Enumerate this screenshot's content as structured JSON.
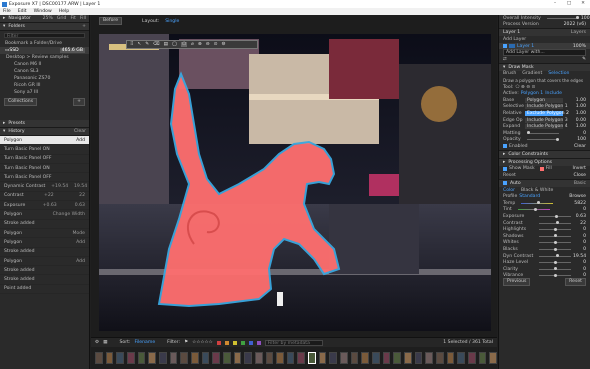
{
  "window": {
    "title": "Exposure X7 | DSC00177.ARW | Layer 1",
    "min": "–",
    "max": "□",
    "close": "✕"
  },
  "menu": [
    "File",
    "Edit",
    "Window",
    "Help"
  ],
  "navigator": {
    "title": "Navigator",
    "zoom": "25%",
    "grid": "Grid",
    "fit": "Fit",
    "fill": "Fill",
    "full": "1:1"
  },
  "folders": {
    "title": "Folders",
    "filter_placeholder": "Filter",
    "bookmark": "Bookmark a Folder/Drive",
    "drive": "SSD",
    "drive_size": "465.6 GB",
    "items": [
      {
        "label": "Desktop > Review samples",
        "level": 0
      },
      {
        "label": "Canon M6 II",
        "level": 1
      },
      {
        "label": "Canon SL3",
        "level": 1
      },
      {
        "label": "Panasonic ZS70",
        "level": 1
      },
      {
        "label": "Ricoh GR III",
        "level": 1
      },
      {
        "label": "Sony a7 III",
        "level": 1
      }
    ],
    "collections": "Collections"
  },
  "presets": {
    "title": "Presets"
  },
  "history": {
    "title": "History",
    "clear": "Clear",
    "rows": [
      {
        "label": "Polygon",
        "a": "Add",
        "b": ""
      },
      {
        "label": "Turn Basic Panel ON",
        "a": "",
        "b": ""
      },
      {
        "label": "Turn Basic Panel OFF",
        "a": "",
        "b": ""
      },
      {
        "label": "Turn Basic Panel ON",
        "a": "",
        "b": ""
      },
      {
        "label": "Turn Basic Panel OFF",
        "a": "",
        "b": ""
      },
      {
        "label": "Dynamic Contrast",
        "a": "+19.54",
        "b": "19.54"
      },
      {
        "label": "Contrast",
        "a": "+22",
        "b": "22"
      },
      {
        "label": "Exposure",
        "a": "+0.63",
        "b": "0.63"
      },
      {
        "label": "Polygon",
        "a": "Change Width",
        "b": ""
      },
      {
        "label": "Stroke added",
        "a": "",
        "b": ""
      },
      {
        "label": "Polygon",
        "a": "Mode",
        "b": ""
      },
      {
        "label": "Polygon",
        "a": "Add",
        "b": ""
      },
      {
        "label": "Stroke added",
        "a": "",
        "b": ""
      },
      {
        "label": "Polygon",
        "a": "Add",
        "b": ""
      },
      {
        "label": "Stroke added",
        "a": "",
        "b": ""
      },
      {
        "label": "Stroke added",
        "a": "",
        "b": ""
      },
      {
        "label": "Point added",
        "a": "",
        "b": ""
      }
    ]
  },
  "viewer": {
    "before": "Before",
    "layout": "Layout:",
    "layout_value": "Single"
  },
  "bottombar": {
    "sort": "Sort:",
    "sort_value": "Filename",
    "filter": "Filter:",
    "stars": "☆☆☆☆☆",
    "filter_placeholder": "Filter by metadata",
    "status": "1 Selected / 361 Total"
  },
  "colors": {
    "accent": "#4aa3ff",
    "mask": "#ff6f6f",
    "label_red": "#d04040",
    "label_orange": "#d08a30",
    "label_yellow": "#d0c030",
    "label_green": "#40a040",
    "label_blue": "#4060d0",
    "label_purple": "#9050c0"
  },
  "right": {
    "overall": "Overall Intensity",
    "overall_val": "100",
    "process": "Process Version",
    "process_val": "2022 (v6)",
    "layer1": "Layer 1",
    "layers": "Layers",
    "add_layer": "Add Layer",
    "layer_name": "Layer 1",
    "layer_opacity": "100%",
    "add_preset": "Add Layer with...",
    "draw_mask": "Draw Mask",
    "brush": "Brush",
    "gradient": "Gradient",
    "selection": "Selection",
    "hint": "Draw a polygon that covers the edges",
    "tool": "Tool:",
    "active": "Active:",
    "active_val": "Polygon 1",
    "include": "Include",
    "base": "Base",
    "base_val": "Polygon",
    "selective": "Selective",
    "selective_val": "Include Polygon 1",
    "relative": "Relative",
    "relative_val": "Exclude Polygon 2",
    "edge": "Edge Op",
    "edge_val": "Include Polygon 3",
    "expand": "Expand",
    "expand_val": "Include Polygon 4",
    "vals": [
      "1.00",
      "1.00",
      "1.00",
      "0.00",
      "1.00"
    ],
    "matting": "Matting",
    "matting_val": "0",
    "opacity": "Opacity",
    "opacity_val": "100",
    "enabled": "Enabled",
    "clear": "Clear",
    "color_constraints": "Color Constraints",
    "processing": "Processing Options",
    "show_mask": "Show Mask",
    "fill": "Fill",
    "invert": "Invert",
    "reset": "Reset",
    "close": "Close",
    "auto": "Auto",
    "basic": "Basic",
    "color": "Color",
    "bw": "Black & White",
    "profile": "Profile",
    "profile_val": "Standard",
    "profile_extra": "Browse",
    "temp": "Temp",
    "temp_val": "5822",
    "tint": "Tint",
    "tint_val": "0",
    "sliders": [
      {
        "label": "Exposure",
        "v": "0.63",
        "pos": 0.55
      },
      {
        "label": "Contrast",
        "v": "22",
        "pos": 0.6
      },
      {
        "label": "Highlights",
        "v": "0",
        "pos": 0.5
      },
      {
        "label": "Shadows",
        "v": "0",
        "pos": 0.5
      },
      {
        "label": "Whites",
        "v": "0",
        "pos": 0.5
      },
      {
        "label": "Blacks",
        "v": "0",
        "pos": 0.5
      },
      {
        "label": "Dyn Contrast",
        "v": "19.54",
        "pos": 0.6
      },
      {
        "label": "Haze Level",
        "v": "0",
        "pos": 0.5
      },
      {
        "label": "Clarity",
        "v": "0",
        "pos": 0.5
      },
      {
        "label": "Vibrance",
        "v": "0",
        "pos": 0.5
      }
    ],
    "previous": "Previous",
    "reset2": "Reset"
  }
}
